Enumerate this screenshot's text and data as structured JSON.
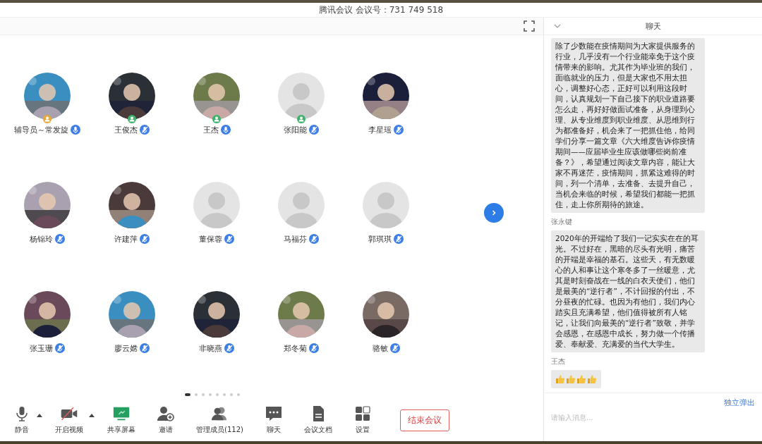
{
  "window": {
    "title": "腾讯会议 会议号：731 749 518"
  },
  "participants": [
    {
      "name": "辅导员～常发旋",
      "photo": true,
      "host": true,
      "cohost": false,
      "muted": false
    },
    {
      "name": "王俊杰",
      "photo": true,
      "host": false,
      "cohost": true,
      "muted": true
    },
    {
      "name": "王杰",
      "photo": true,
      "host": false,
      "cohost": true,
      "muted": false
    },
    {
      "name": "张阳能",
      "photo": false,
      "host": false,
      "cohost": true,
      "muted": true
    },
    {
      "name": "李星瑶",
      "photo": true,
      "host": false,
      "cohost": false,
      "muted": true
    },
    {
      "name": "杨锦玲",
      "photo": true,
      "host": false,
      "cohost": false,
      "muted": true
    },
    {
      "name": "许建萍",
      "photo": true,
      "host": false,
      "cohost": false,
      "muted": true
    },
    {
      "name": "董保蓉",
      "photo": false,
      "host": false,
      "cohost": false,
      "muted": true
    },
    {
      "name": "马福芬",
      "photo": false,
      "host": false,
      "cohost": false,
      "muted": true
    },
    {
      "name": "郭琪琪",
      "photo": false,
      "host": false,
      "cohost": false,
      "muted": true
    },
    {
      "name": "张玉珊",
      "photo": true,
      "host": false,
      "cohost": false,
      "muted": true
    },
    {
      "name": "廖云嫦",
      "photo": true,
      "host": false,
      "cohost": false,
      "muted": true
    },
    {
      "name": "非晓燕",
      "photo": true,
      "host": false,
      "cohost": false,
      "muted": true
    },
    {
      "name": "郑冬菊",
      "photo": true,
      "host": false,
      "cohost": false,
      "muted": true
    },
    {
      "name": "骆敏",
      "photo": true,
      "host": false,
      "cohost": false,
      "muted": true
    }
  ],
  "pages": [
    {
      "selected": true
    },
    {
      "selected": false
    },
    {
      "selected": false
    },
    {
      "selected": false
    },
    {
      "selected": false
    },
    {
      "selected": false
    },
    {
      "selected": false
    },
    {
      "selected": false
    }
  ],
  "toolbar": [
    {
      "kind": "mic",
      "label": "静音"
    },
    {
      "kind": "caret"
    },
    {
      "kind": "camera_off",
      "label": "开启视频"
    },
    {
      "kind": "caret"
    },
    {
      "kind": "screen",
      "label": "共享屏幕"
    },
    {
      "kind": "invite",
      "label": "邀请"
    },
    {
      "kind": "members",
      "label": "管理成员(112)"
    },
    {
      "kind": "chat",
      "label": "聊天"
    },
    {
      "kind": "document",
      "label": "会议文档"
    },
    {
      "kind": "settings",
      "label": "设置"
    }
  ],
  "end_button": "结束会议",
  "chat": {
    "title": "聊天",
    "messages": [
      {
        "text": "除了少数能在疫情期间为大家提供服务的行业，几乎没有一个行业能幸免于这个疫情带来的影响。尤其作为毕业班的我们，面临就业的压力，但是大家也不用太担心，调整好心态，正好可以利用这段时间，认真规划一下自己接下的职业道路要怎么走，再好好做面试准备，从身理到心理、从专业维度到职业维度、从思维到行为都准备好，机会来了一把抓住他，给同学们分享一篇文章《六大维度告诉你疫情期间——应届毕业生应该做哪些岗前准备？》，希望通过阅读文章内容，能让大家不再迷茫，疫情期间，抓紧这难得的时间，列一个清单，去准备、去提升自己，当机会来临的时候，希望我们都能一把抓住，走上你所期待的旅途。"
      },
      {
        "sender": "张永键",
        "text": "2020年的开端给了我们一记实实在在的耳光。不过好在，黑暗的尽头有光明，痛苦的开端是幸福的基石。这些天，有无数暖心的人和事让这个寒冬多了一丝暖意，尤其是时刻奋战在一线的白衣天使们，他们是最美的“逆行者”，不计回报的付出，不分昼夜的忙碌。也因为有他们，我们内心踏实且充满希望，他们值得被所有人铭记，让我们向最美的“逆行者”致敬，并学会感恩，在感恩中成长，努力做一个传播爱、奉献爱、充满爱的当代大学生。"
      },
      {
        "sender": "王杰",
        "icons": [
          {
            "kind": "thumbs_up"
          },
          {
            "kind": "thumbs_up"
          },
          {
            "kind": "thumbs_up"
          },
          {
            "kind": "thumbs_up"
          }
        ]
      }
    ],
    "popout": "独立弹出",
    "input": {
      "placeholder": "请输入消息..."
    }
  }
}
